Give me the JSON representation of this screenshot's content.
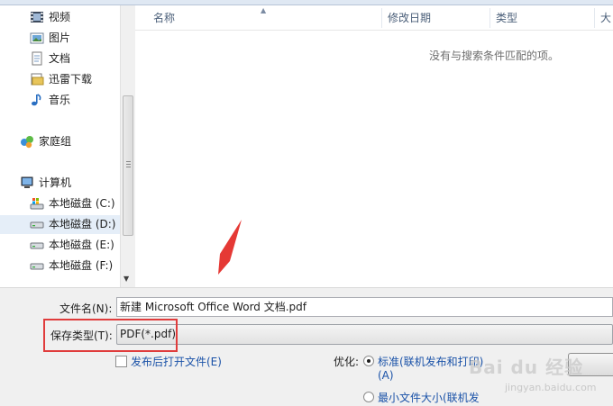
{
  "nav": {
    "items": [
      {
        "label": "视频",
        "icon": "video-library-icon"
      },
      {
        "label": "图片",
        "icon": "picture-library-icon"
      },
      {
        "label": "文档",
        "icon": "document-library-icon"
      },
      {
        "label": "迅雷下载",
        "icon": "folder-icon"
      },
      {
        "label": "音乐",
        "icon": "music-library-icon"
      },
      {
        "label": "家庭组",
        "icon": "homegroup-icon"
      },
      {
        "label": "计算机",
        "icon": "computer-icon"
      },
      {
        "label": "本地磁盘 (C:)",
        "icon": "system-drive-icon"
      },
      {
        "label": "本地磁盘 (D:)",
        "icon": "drive-icon",
        "selected": true
      },
      {
        "label": "本地磁盘 (E:)",
        "icon": "drive-icon"
      },
      {
        "label": "本地磁盘 (F:)",
        "icon": "drive-icon"
      }
    ]
  },
  "files": {
    "columns": [
      "名称",
      "修改日期",
      "类型",
      "大"
    ],
    "empty_message": "没有与搜索条件匹配的项。"
  },
  "form": {
    "filename_label": "文件名(N):",
    "filename_value": "新建 Microsoft Office Word 文档.pdf",
    "filetype_label": "保存类型(T):",
    "filetype_value": "PDF(*.pdf)",
    "open_after_publish": "发布后打开文件(E)",
    "optimize_label": "优化:",
    "option_standard": "标准(联机发布和打印)",
    "option_standard_key": "(A)",
    "option_minimum": "最小文件大小(联机发",
    "option_minimum_selected": false,
    "option_standard_selected": true
  },
  "watermark": {
    "brand": "Bai du 经验",
    "sub": "jingyan.baidu.com"
  },
  "colors": {
    "highlight_box": "#e03c3c",
    "arrow": "#e53935",
    "link_blue": "#1a52a8"
  }
}
